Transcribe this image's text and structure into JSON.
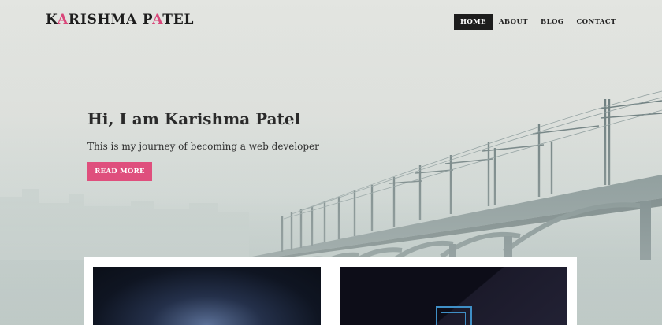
{
  "header": {
    "logo": {
      "part1": "K",
      "accent1": "A",
      "part2": "RISHMA P",
      "accent2": "A",
      "part3": "TEL"
    },
    "nav": [
      {
        "label": "HOME",
        "active": true
      },
      {
        "label": "ABOUT",
        "active": false
      },
      {
        "label": "BLOG",
        "active": false
      },
      {
        "label": "CONTACT",
        "active": false
      }
    ]
  },
  "hero": {
    "title": "Hi, I am Karishma Patel",
    "subtitle": "This is my journey of becoming a web developer",
    "button_label": "READ MORE",
    "background": "misty railway bridge"
  },
  "colors": {
    "accent": "#df4f7d",
    "nav_active_bg": "#1d1d1d",
    "text_dark": "#2a2a2a"
  },
  "cards": [
    {
      "image": "starry night sky"
    },
    {
      "image": "dark laptop screen"
    }
  ]
}
